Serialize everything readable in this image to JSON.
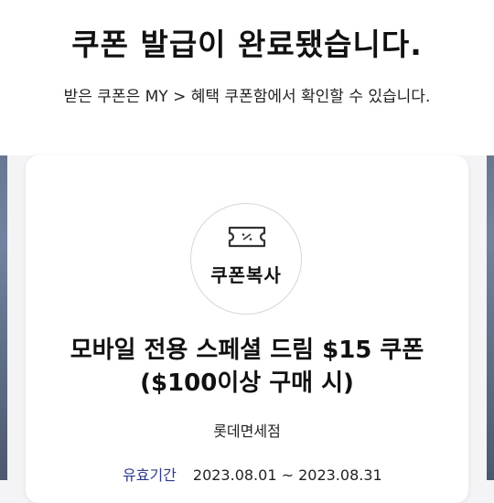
{
  "header": {
    "title": "쿠폰 발급이 완료됐습니다.",
    "subtitle": "받은 쿠폰은 MY > 혜택 쿠폰함에서 확인할 수 있습니다."
  },
  "coupon": {
    "copy_label": "쿠폰복사",
    "name_line1": "모바일 전용 스페셜 드림 $15 쿠폰",
    "name_line2": "($100이상 구매 시)",
    "store": "롯데면세점",
    "validity_label": "유효기간",
    "validity_value": "2023.08.01 ~ 2023.08.31"
  },
  "colors": {
    "accent": "#2d3a8c",
    "background": "#f4f4f6",
    "card": "#ffffff"
  },
  "icons": {
    "copy": "coupon-ticket-icon"
  }
}
